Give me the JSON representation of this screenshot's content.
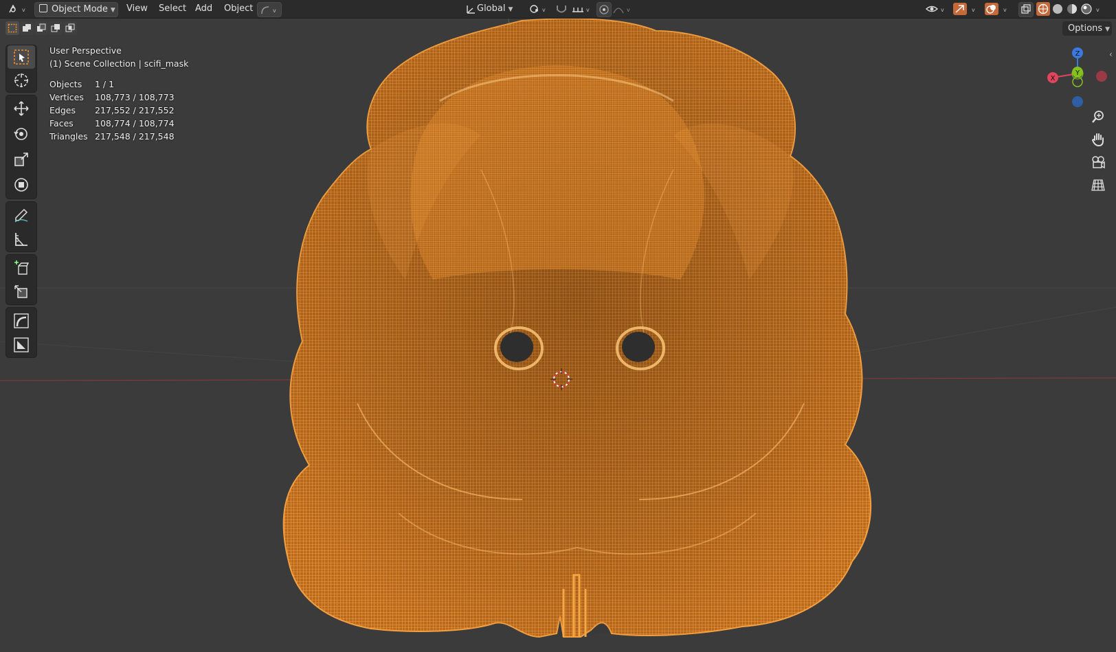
{
  "header": {
    "mode_label": "Object Mode",
    "menus": [
      "View",
      "Select",
      "Add",
      "Object"
    ],
    "transform_orientation": "Global"
  },
  "overlay": {
    "view_name": "User Perspective",
    "collection_line": "(1) Scene Collection | scifi_mask",
    "stats": [
      {
        "label": "Objects",
        "value": "1 / 1"
      },
      {
        "label": "Vertices",
        "value": "108,773 / 108,773"
      },
      {
        "label": "Edges",
        "value": "217,552 / 217,552"
      },
      {
        "label": "Faces",
        "value": "108,774 / 108,774"
      },
      {
        "label": "Triangles",
        "value": "217,548 / 217,548"
      }
    ]
  },
  "options_label": "Options",
  "gizmo": {
    "x": "X",
    "y": "Y",
    "z": "Z"
  },
  "colors": {
    "wire": "#f39a2e",
    "background": "#3b3b3b",
    "x_axis": "#e0455e",
    "y_axis": "#84c11f",
    "z_axis": "#3a7ae0",
    "active_tool": "#f3902f"
  },
  "tools": [
    "select-box",
    "cursor",
    "move",
    "rotate",
    "scale",
    "transform",
    "annotate",
    "measure",
    "add-cube",
    "shear",
    "bend",
    "shrink"
  ]
}
